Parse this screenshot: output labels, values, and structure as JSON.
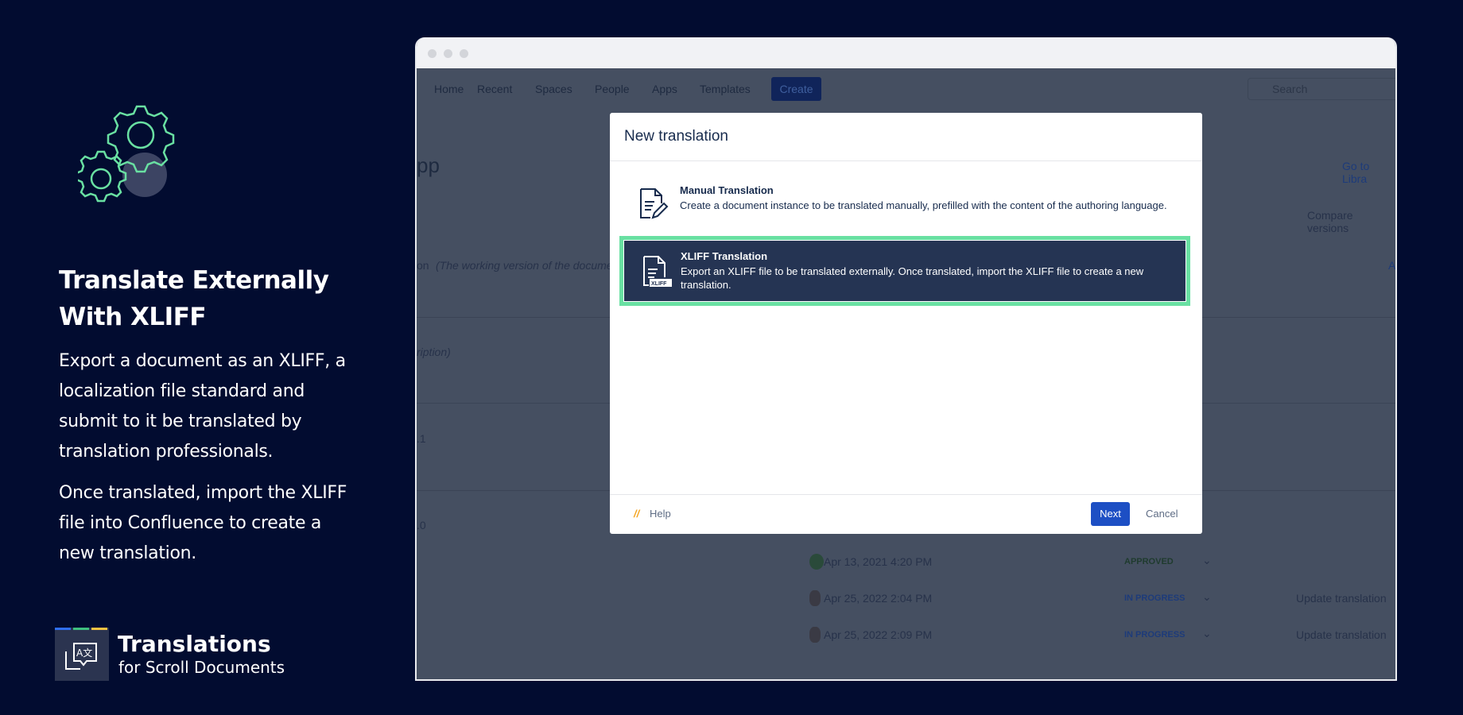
{
  "left": {
    "title": "Translate Externally With XLIFF",
    "paragraph1": "Export a document as an XLIFF, a localization file standard and submit to it be translated by translation professionals.",
    "paragraph2": "Once translated, import the XLIFF file into Confluence to create a new translation."
  },
  "logo": {
    "title": "Translations",
    "subtitle": "for Scroll Documents",
    "colors": [
      "#2f6ff0",
      "#3fbf7f",
      "#f5c242"
    ]
  },
  "browser": {
    "nav": {
      "home": "Home",
      "recent": "Recent",
      "spaces": "Spaces",
      "people": "People",
      "apps": "Apps",
      "templates": "Templates",
      "create": "Create",
      "search_placeholder": "Search"
    },
    "background": {
      "page_title_fragment": "pp",
      "go_to_library": "Go to Libra",
      "compare_versions": "Compare versions",
      "working_version": "on",
      "working_version_note": "(The working version of the documen",
      "description_fragment": "ription)",
      "version_1": ".1",
      "version_0": ".0",
      "action_fragment": "A",
      "rows": [
        {
          "date": "Apr 13, 2021 4:20 PM",
          "status": "APPROVED",
          "action": ""
        },
        {
          "date": "Apr 25, 2022 2:04 PM",
          "status": "IN PROGRESS",
          "action": "Update translation"
        },
        {
          "date": "Apr 25, 2022 2:09 PM",
          "status": "IN PROGRESS",
          "action": "Update translation"
        }
      ]
    },
    "modal": {
      "title": "New translation",
      "options": [
        {
          "title": "Manual Translation",
          "description": "Create a document instance to be translated manually, prefilled with the content of the authoring language."
        },
        {
          "title": "XLIFF Translation",
          "description": "Export an XLIFF file to be translated externally. Once translated, import the XLIFF file to create a new translation.",
          "badge": "XLIFF",
          "selected": true
        }
      ],
      "help": "Help",
      "next": "Next",
      "cancel": "Cancel"
    }
  },
  "colors": {
    "background": "#020c30",
    "accent": "#69e0a2",
    "primary_button": "#1d4fc4"
  }
}
